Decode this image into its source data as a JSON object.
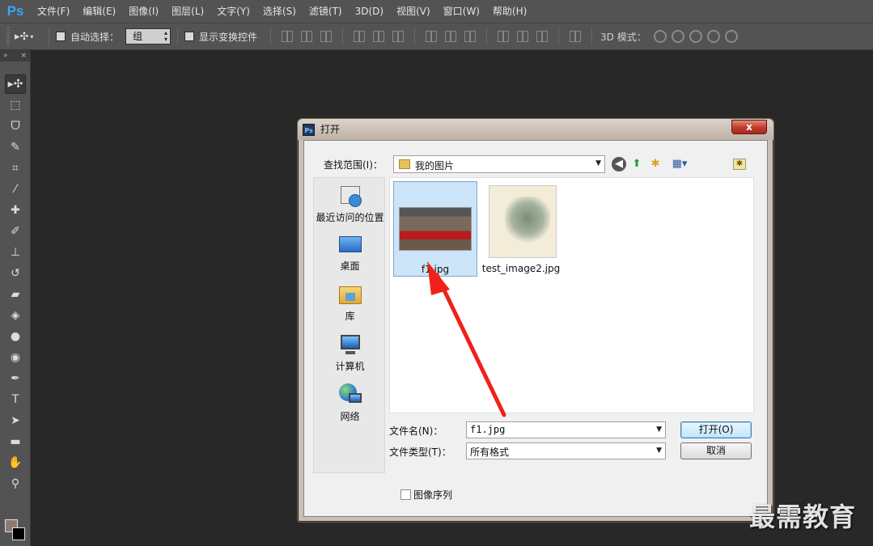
{
  "app": {
    "logo": "Ps"
  },
  "menu": [
    "文件(F)",
    "编辑(E)",
    "图像(I)",
    "图层(L)",
    "文字(Y)",
    "选择(S)",
    "滤镜(T)",
    "3D(D)",
    "视图(V)",
    "窗口(W)",
    "帮助(H)"
  ],
  "options": {
    "auto_select_label": "自动选择：",
    "auto_select_value": "组",
    "show_transform_label": "显示变换控件",
    "mode3d_label": "3D 模式："
  },
  "colors": {
    "foreground": "#8d7b6f",
    "background": "#000000",
    "accent": "#31a8ff"
  },
  "dialog": {
    "title": "打开",
    "close_label": "x",
    "lookin_label": "查找范围(I)：",
    "lookin_value": "我的图片",
    "places": [
      {
        "label": "最近访问的位置",
        "icon": "recent-places-icon"
      },
      {
        "label": "桌面",
        "icon": "desktop-icon"
      },
      {
        "label": "库",
        "icon": "libraries-icon"
      },
      {
        "label": "计算机",
        "icon": "computer-icon"
      },
      {
        "label": "网络",
        "icon": "network-icon"
      }
    ],
    "files": [
      {
        "name": "f1.jpg",
        "selected": true
      },
      {
        "name": "test_image2.jpg",
        "selected": false
      }
    ],
    "filename_label": "文件名(N)：",
    "filename_value": "f1.jpg",
    "filetype_label": "文件类型(T)：",
    "filetype_value": "所有格式",
    "open_button": "打开(O)",
    "cancel_button": "取消",
    "image_sequence_label": "图像序列"
  },
  "watermark": "最需教育"
}
